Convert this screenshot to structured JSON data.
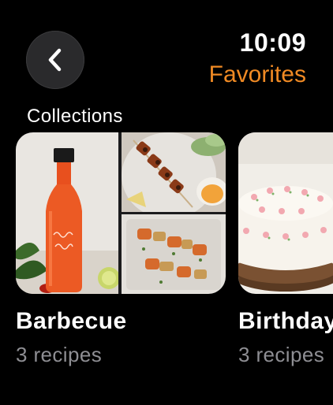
{
  "status": {
    "time": "10:09"
  },
  "nav": {
    "title": "Favorites",
    "accent_color": "#F08A24",
    "back_icon": "chevron-left-icon"
  },
  "section": {
    "label": "Collections"
  },
  "collections": [
    {
      "title": "Barbecue",
      "subtitle": "3 recipes",
      "images": [
        "hot-sauce-bottle",
        "grilled-skewers-plate",
        "vegetable-skewers-tray"
      ]
    },
    {
      "title": "Birthday",
      "subtitle": "3 recipes",
      "images": [
        "frosted-cake"
      ]
    }
  ]
}
